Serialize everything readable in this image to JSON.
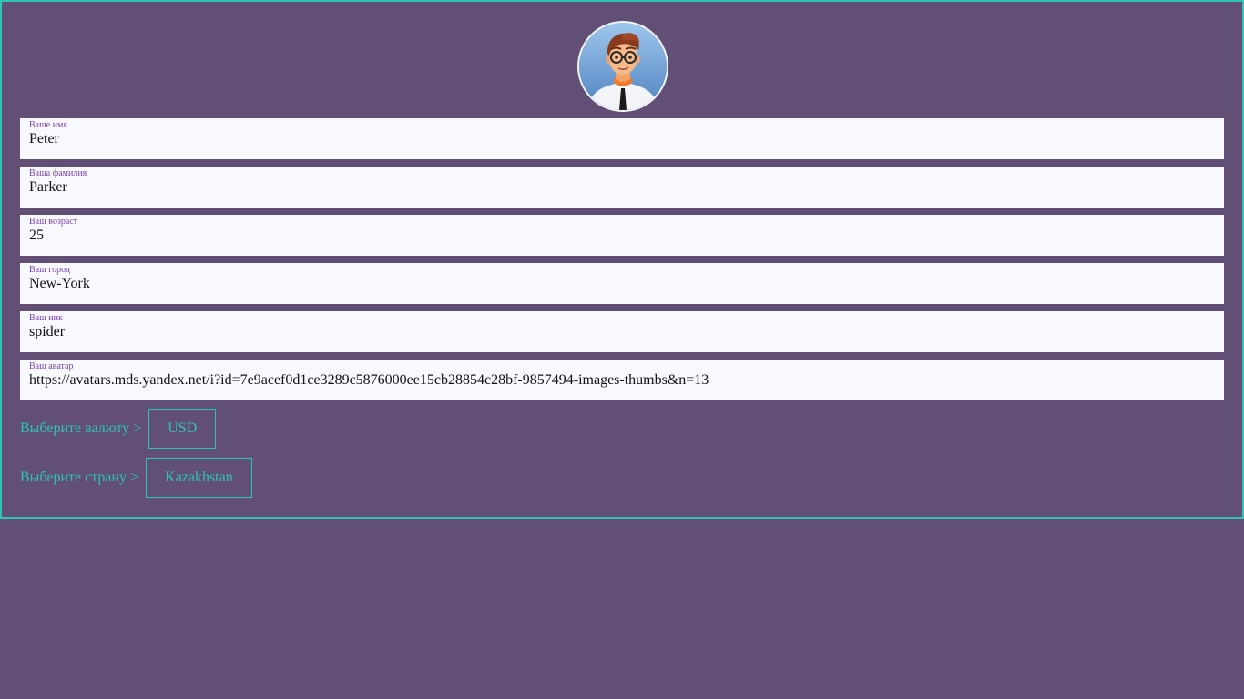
{
  "profile": {
    "fields": [
      {
        "label": "Ваше имя",
        "value": "Peter"
      },
      {
        "label": "Ваша фамилия",
        "value": "Parker"
      },
      {
        "label": "Ваш возраст",
        "value": "25"
      },
      {
        "label": "Ваш город",
        "value": "New-York"
      },
      {
        "label": "Ваш ник",
        "value": "spider"
      },
      {
        "label": "Ваш аватар",
        "value": "https://avatars.mds.yandex.net/i?id=7e9acef0d1ce3289c5876000ee15cb28854c28bf-9857494-images-thumbs&n=13"
      }
    ],
    "currency": {
      "prompt": "Выберите валюту >",
      "selected": "USD"
    },
    "country": {
      "prompt": "Выберите страну >",
      "selected": "Kazakhstan"
    }
  },
  "colors": {
    "background": "#614f75",
    "accent": "#2ec4b6",
    "label": "#7d3fb2",
    "field_bg": "#f7f9ff"
  },
  "icons": {
    "avatar": "cartoon-man-avatar"
  }
}
